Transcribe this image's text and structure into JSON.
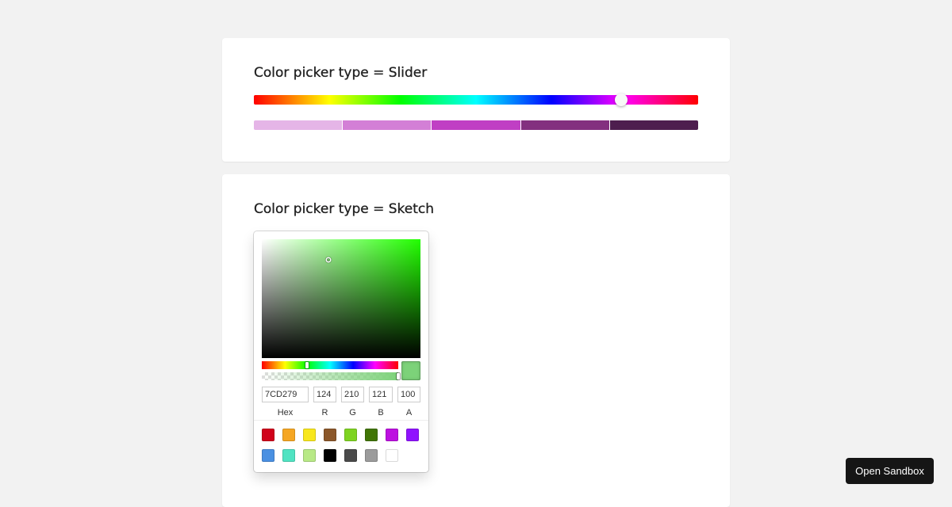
{
  "slider_section": {
    "title": "Color picker type = Slider",
    "hue_value": 0.827,
    "shades": [
      "#e5b5e7",
      "#d37fd6",
      "#c03fc4",
      "#83307f",
      "#4e1e4f"
    ]
  },
  "sketch_section": {
    "title": "Color picker type = Sketch",
    "hue_color": "#22ff00",
    "color": "#7CD279",
    "saturation": 0.42,
    "brightness": 0.83,
    "hue_position": 0.33,
    "alpha_position": 1.0,
    "fields": {
      "hex": {
        "label": "Hex",
        "value": "7CD279"
      },
      "r": {
        "label": "R",
        "value": "124"
      },
      "g": {
        "label": "G",
        "value": "210"
      },
      "b": {
        "label": "B",
        "value": "121"
      },
      "a": {
        "label": "A",
        "value": "100"
      }
    },
    "presets": [
      "#d0021b",
      "#f5a623",
      "#f8e71c",
      "#8b572a",
      "#7ed321",
      "#417505",
      "#bd10e0",
      "#9013fe",
      "#4a90e2",
      "#50e3c2",
      "#b8e986",
      "#000000",
      "#4a4a4a",
      "#9b9b9b",
      "#ffffff"
    ]
  },
  "sandbox_button": {
    "label": "Open Sandbox"
  }
}
